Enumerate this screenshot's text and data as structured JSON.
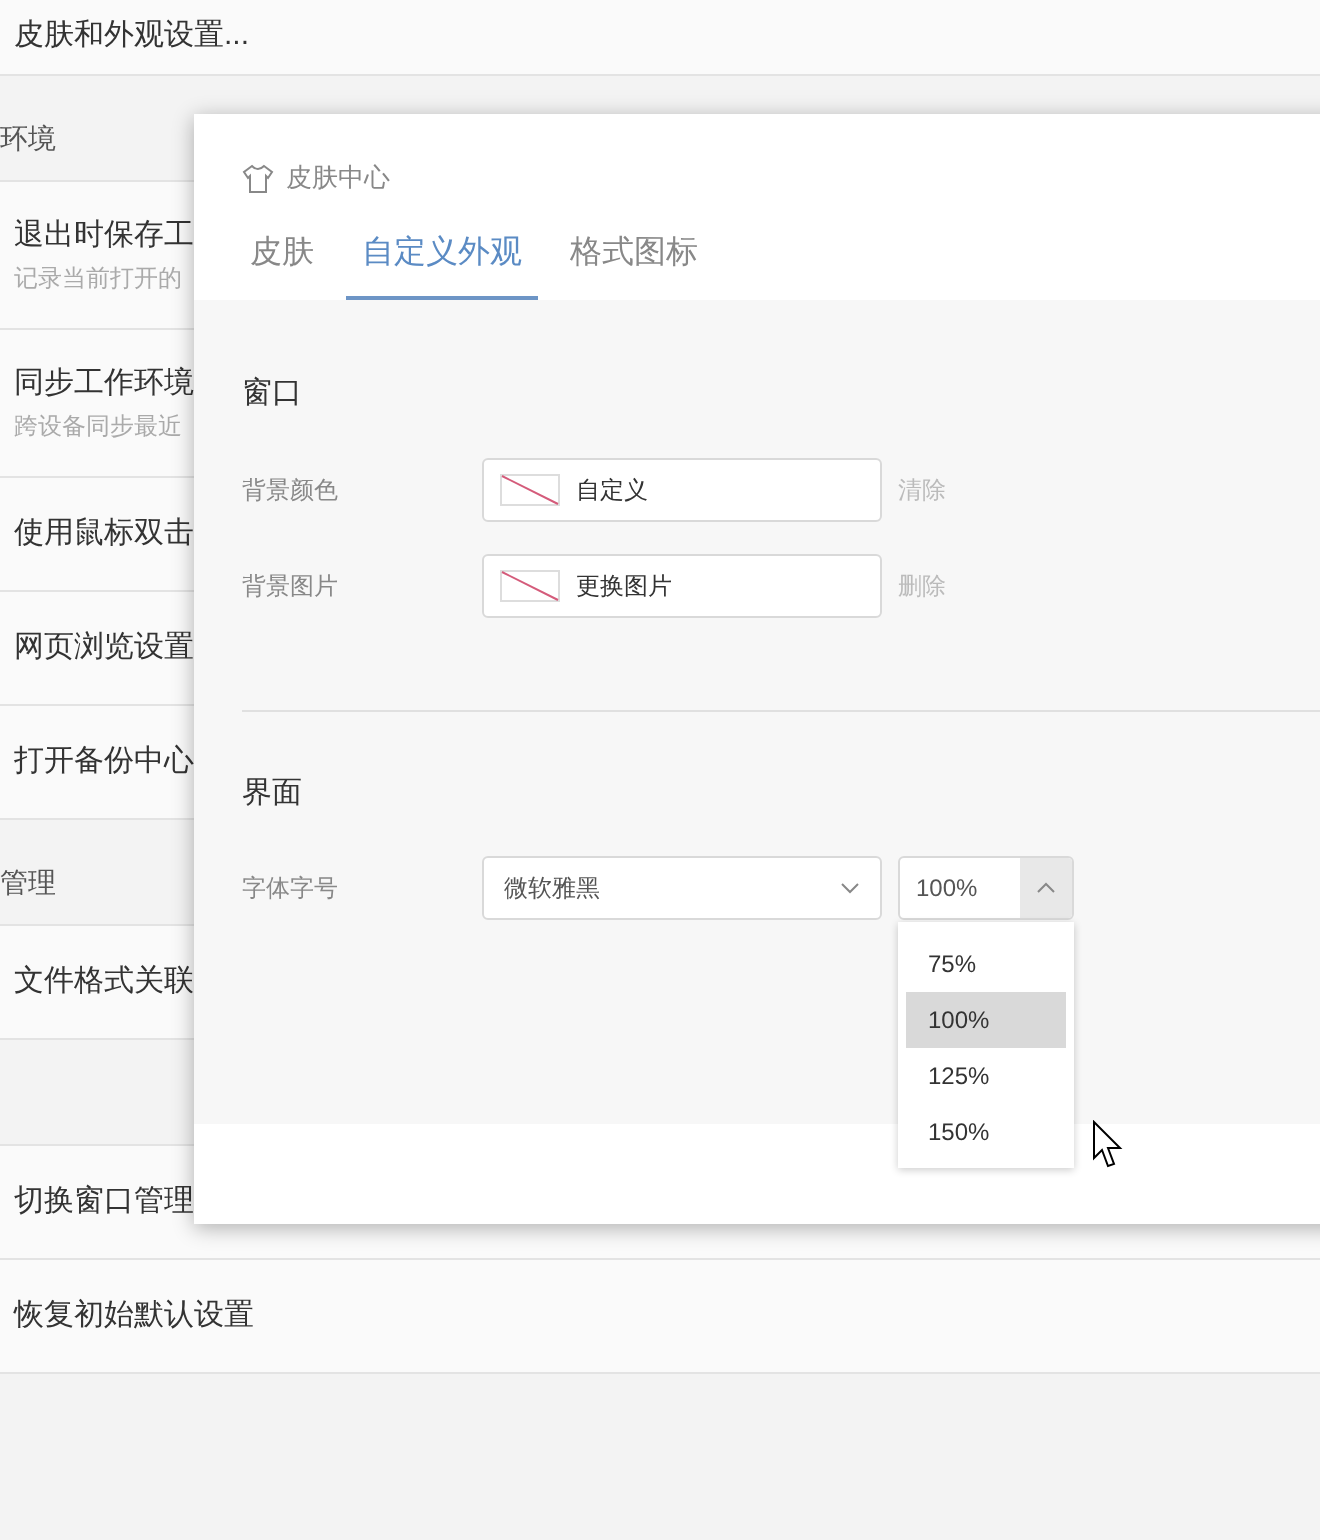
{
  "background": {
    "top_item": "皮肤和外观设置...",
    "rows": [
      {
        "kind": "header",
        "label": "环境"
      },
      {
        "kind": "item",
        "label": "退出时保存工",
        "sub": "记录当前打开的"
      },
      {
        "kind": "item",
        "label": "同步工作环境",
        "sub": "跨设备同步最近"
      },
      {
        "kind": "item",
        "label": "使用鼠标双击"
      },
      {
        "kind": "item",
        "label": "网页浏览设置"
      },
      {
        "kind": "item",
        "label": "打开备份中心"
      },
      {
        "kind": "header",
        "label": "管理"
      },
      {
        "kind": "item",
        "label": "文件格式关联"
      },
      {
        "kind": "header"
      },
      {
        "kind": "item",
        "label": "切换窗口管理"
      },
      {
        "kind": "item",
        "label": "恢复初始默认设置"
      }
    ]
  },
  "dialog": {
    "title": "皮肤中心",
    "tabs": [
      {
        "label": "皮肤",
        "selected": false
      },
      {
        "label": "自定义外观",
        "selected": true
      },
      {
        "label": "格式图标",
        "selected": false
      }
    ],
    "sections": [
      {
        "title": "窗口",
        "fields": [
          {
            "kind": "swatch",
            "label": "背景颜色",
            "value": "自定义",
            "action": "清除"
          },
          {
            "kind": "swatch",
            "label": "背景图片",
            "value": "更换图片",
            "action": "删除"
          }
        ]
      },
      {
        "title": "界面",
        "fields": [
          {
            "kind": "font",
            "label": "字体字号",
            "value": "微软雅黑",
            "size": "100%",
            "expanded": true,
            "options": [
              {
                "label": "75%",
                "selected": false
              },
              {
                "label": "100%",
                "selected": true
              },
              {
                "label": "125%",
                "selected": false
              },
              {
                "label": "150%",
                "selected": false
              }
            ]
          }
        ]
      }
    ]
  }
}
